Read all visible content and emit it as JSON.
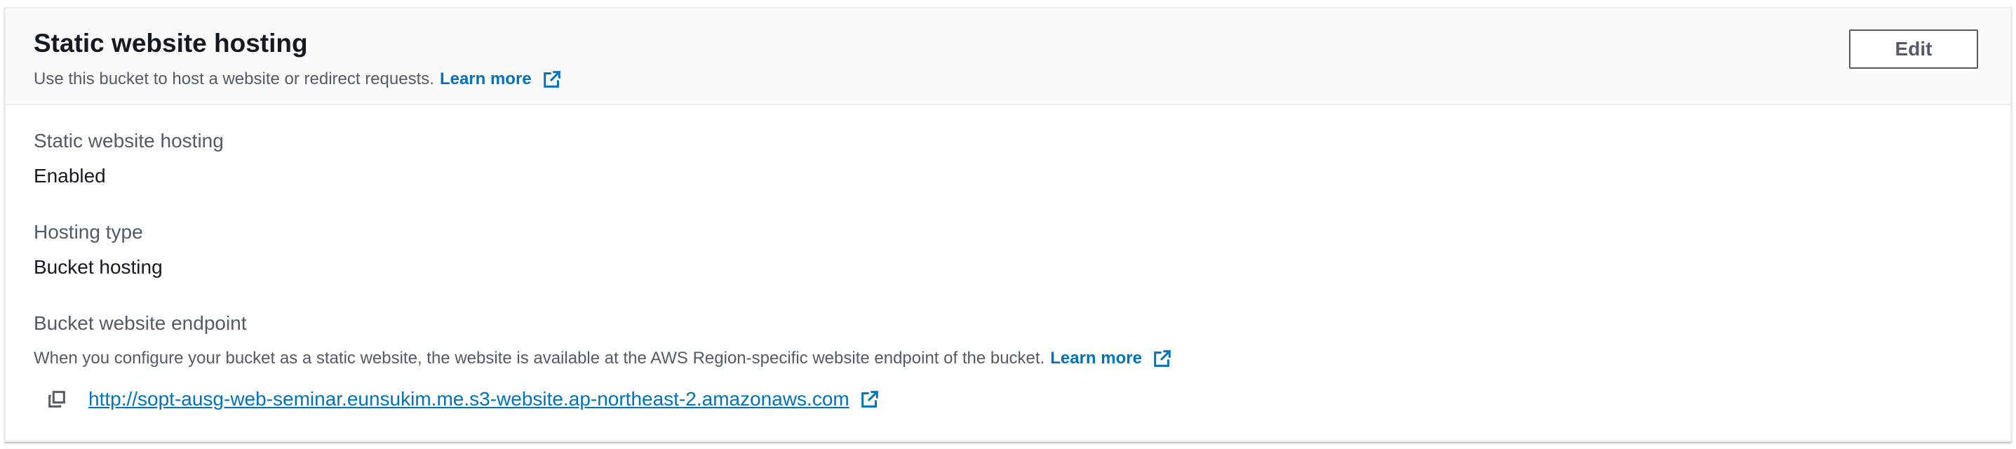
{
  "header": {
    "title": "Static website hosting",
    "description": "Use this bucket to host a website or redirect requests.",
    "learn_more": "Learn more",
    "edit_label": "Edit"
  },
  "fields": {
    "hosting": {
      "label": "Static website hosting",
      "value": "Enabled"
    },
    "hosting_type": {
      "label": "Hosting type",
      "value": "Bucket hosting"
    },
    "endpoint": {
      "label": "Bucket website endpoint",
      "description": "When you configure your bucket as a static website, the website is available at the AWS Region-specific website endpoint of the bucket.",
      "learn_more": "Learn more",
      "url": "http://sopt-ausg-web-seminar.eunsukim.me.s3-website.ap-northeast-2.amazonaws.com"
    }
  },
  "icons": {
    "external_link": "external-link-icon",
    "copy": "copy-icon"
  },
  "colors": {
    "link": "#0073bb",
    "label": "#545b64",
    "text": "#16191f",
    "header_bg": "#fafafa",
    "border": "#eaeded"
  }
}
